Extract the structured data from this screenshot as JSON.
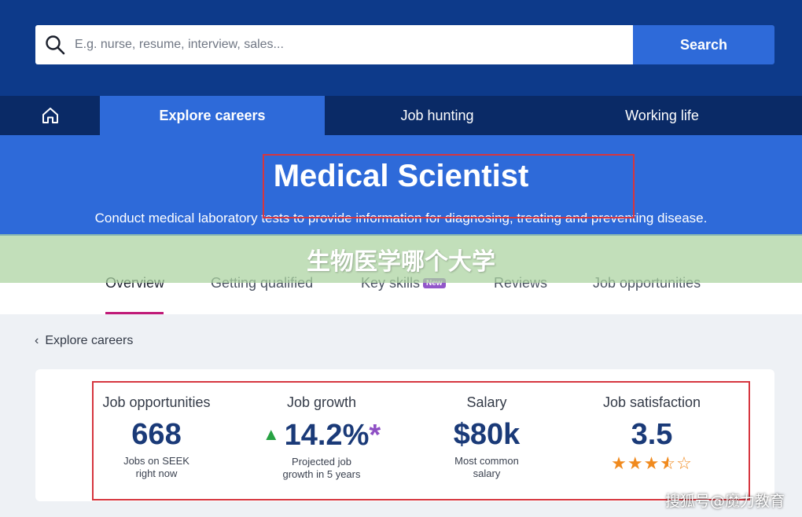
{
  "search": {
    "placeholder": "E.g. nurse, resume, interview, sales...",
    "button_label": "Search"
  },
  "nav": {
    "tabs": [
      {
        "label": "Explore careers",
        "active": true
      },
      {
        "label": "Job hunting",
        "active": false
      },
      {
        "label": "Working life",
        "active": false
      }
    ]
  },
  "hero": {
    "title": "Medical Scientist",
    "description": "Conduct medical laboratory tests to provide information for diagnosing, treating and preventing disease."
  },
  "overlay": {
    "text": "生物医学哪个大学"
  },
  "subnav": {
    "tabs": [
      {
        "label": "Overview",
        "active": true
      },
      {
        "label": "Getting qualified",
        "active": false
      },
      {
        "label": "Key skills",
        "active": false,
        "badge": "New"
      },
      {
        "label": "Reviews",
        "active": false
      },
      {
        "label": "Job opportunities",
        "active": false
      }
    ]
  },
  "breadcrumb": {
    "label": "Explore careers"
  },
  "stats": [
    {
      "label": "Job opportunities",
      "value": "668",
      "sub1": "Jobs on SEEK",
      "sub2": "right now"
    },
    {
      "label": "Job growth",
      "value": "14.2%",
      "value_mark": "*",
      "sub1": "Projected job",
      "sub2": "growth in 5 years"
    },
    {
      "label": "Salary",
      "value": "$80k",
      "sub1": "Most common",
      "sub2": "salary"
    },
    {
      "label": "Job satisfaction",
      "value": "3.5",
      "rating": 3.5,
      "rating_max": 5
    }
  ],
  "watermark": "搜狐号@魔力教育",
  "colors": {
    "top_bar": "#0d3a8a",
    "accent_blue": "#2e6ad9",
    "nav_dark": "#0a2a66",
    "highlight_red": "#d6363f",
    "active_underline": "#c01a78",
    "growth_green": "#27a243",
    "star_orange": "#f08a1e",
    "stat_value_navy": "#1a3a78"
  }
}
